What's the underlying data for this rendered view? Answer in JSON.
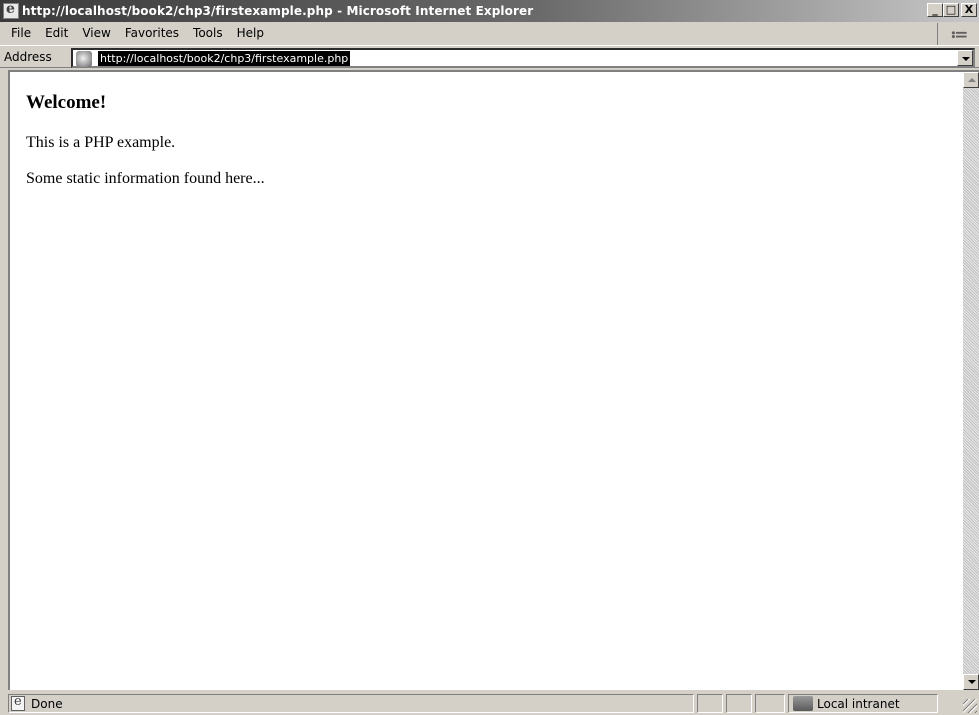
{
  "window": {
    "title": "http://localhost/book2/chp3/firstexample.php - Microsoft Internet Explorer",
    "buttons": {
      "minimize": "_",
      "maximize": "□",
      "close": "X"
    }
  },
  "menu": {
    "items": [
      "File",
      "Edit",
      "View",
      "Favorites",
      "Tools",
      "Help"
    ]
  },
  "address": {
    "label": "Address",
    "url": "http://localhost/book2/chp3/firstexample.php"
  },
  "page": {
    "heading": "Welcome!",
    "paragraphs": [
      "This is a PHP example.",
      "Some static information found here..."
    ]
  },
  "status": {
    "text": "Done",
    "zone": "Local intranet"
  },
  "icons": {
    "title": "ie-page-icon",
    "throbber": "windows-logo-icon",
    "address": "page-icon",
    "status": "page-done-icon",
    "zone": "local-intranet-icon"
  }
}
